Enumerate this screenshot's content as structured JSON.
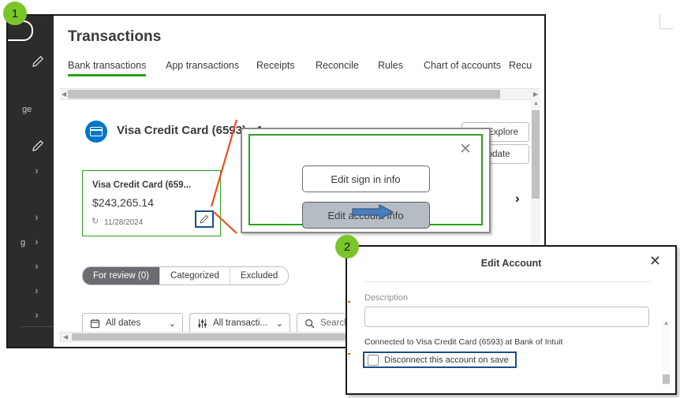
{
  "badges": {
    "step1": "1",
    "step2": "2"
  },
  "app": {
    "page_title": "Transactions",
    "tabs": [
      {
        "label": "Bank transactions",
        "active": true
      },
      {
        "label": "App transactions",
        "active": false
      },
      {
        "label": "Receipts",
        "active": false
      },
      {
        "label": "Reconcile",
        "active": false
      },
      {
        "label": "Rules",
        "active": false
      },
      {
        "label": "Chart of accounts",
        "active": false
      },
      {
        "label": "Recu",
        "active": false
      }
    ],
    "account": {
      "name": "Visa Credit Card (6593) - 1",
      "caret_icon": "chevron-down-icon",
      "icon": "credit-card-icon"
    },
    "buttons": {
      "explore": "Explore",
      "update": "Update",
      "explore_icon": "atom-icon"
    },
    "card_tile": {
      "name": "Visa Credit Card (659...",
      "balance": "$243,265.14",
      "updated": "11/28/2024",
      "refresh_icon": "refresh-icon",
      "edit_icon": "pencil-icon"
    },
    "row_chevron_icon": "chevron-right-icon",
    "review_tabs": [
      {
        "label": "For review (0)",
        "selected": true
      },
      {
        "label": "Categorized",
        "selected": false
      },
      {
        "label": "Excluded",
        "selected": false
      }
    ],
    "filters": {
      "dates": {
        "value": "All dates",
        "icon": "calendar-icon",
        "caret": "chevron-down-icon"
      },
      "type": {
        "value": "All transacti...",
        "icon": "sliders-icon",
        "caret": "chevron-down-icon"
      },
      "search": {
        "placeholder": "Search",
        "icon": "search-icon"
      }
    },
    "sidebar": {
      "fragments": [
        "ge",
        "g"
      ],
      "pencil_icon": "pencil-icon",
      "chevron_icon": "chevron-right-icon"
    }
  },
  "popup": {
    "close_icon": "close-icon",
    "sign_in_button": "Edit sign in info",
    "account_button": "Edit account info",
    "pointer_icon": "blue-arrow-icon"
  },
  "dialog": {
    "title": "Edit Account",
    "close_icon": "close-icon",
    "description_label": "Description",
    "description_value": "",
    "connected_text": "Connected to Visa Credit Card (6593) at Bank of Intuit",
    "disconnect_label": "Disconnect this account on save",
    "disconnect_checked": false
  },
  "colors": {
    "brand_green": "#2ca01c",
    "badge_green": "#7ac529",
    "accent_blue": "#0077c5",
    "highlight_blue": "#1c4e8a",
    "callout_orange": "#ef4b1e",
    "selected_gray": "#6b6c72"
  }
}
